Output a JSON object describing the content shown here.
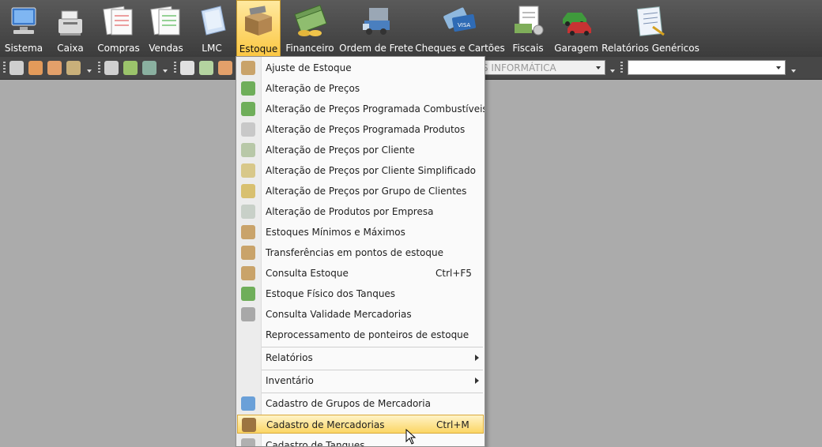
{
  "topbar": {
    "items": [
      {
        "label": "Sistema",
        "icon": "computer-icon"
      },
      {
        "label": "Caixa",
        "icon": "cash-register-icon"
      },
      {
        "label": "Compras",
        "icon": "purchase-forms-icon"
      },
      {
        "label": "Vendas",
        "icon": "sales-forms-icon"
      },
      {
        "label": "LMC",
        "icon": "document-icon"
      },
      {
        "label": "Estoque",
        "icon": "stock-box-icon"
      },
      {
        "label": "Financeiro",
        "icon": "money-icon"
      },
      {
        "label": "Ordem de Frete",
        "icon": "truck-icon"
      },
      {
        "label": "Cheques e Cartões",
        "icon": "cards-icon"
      },
      {
        "label": "Fiscais",
        "icon": "fiscal-icon"
      },
      {
        "label": "Garagem",
        "icon": "cars-icon"
      },
      {
        "label": "Relatórios Genéricos",
        "icon": "reports-icon"
      }
    ]
  },
  "toolbar2": {
    "company_combo": "S INFORMÁTICA",
    "second_combo": ""
  },
  "menu": {
    "items": [
      {
        "label": "Ajuste de Estoque",
        "shortcut": "",
        "icon": "stock-adjust-icon"
      },
      {
        "label": "Alteração de Preços",
        "shortcut": "",
        "icon": "price-change-icon"
      },
      {
        "label": "Alteração de Preços Programada Combustíveis",
        "shortcut": "",
        "icon": "price-fuel-icon"
      },
      {
        "label": "Alteração de Preços Programada Produtos",
        "shortcut": "",
        "icon": "price-products-icon"
      },
      {
        "label": "Alteração de Preços por Cliente",
        "shortcut": "",
        "icon": "price-client-icon"
      },
      {
        "label": "Alteração de Preços por Cliente Simplificado",
        "shortcut": "",
        "icon": "price-client-simple-icon"
      },
      {
        "label": "Alteração de Preços por Grupo de Clientes",
        "shortcut": "",
        "icon": "price-group-icon"
      },
      {
        "label": "Alteração de Produtos por Empresa",
        "shortcut": "",
        "icon": "products-company-icon"
      },
      {
        "label": "Estoques Mínimos e Máximos",
        "shortcut": "",
        "icon": "stock-minmax-icon"
      },
      {
        "label": "Transferências em pontos de estoque",
        "shortcut": "",
        "icon": "transfer-icon"
      },
      {
        "label": "Consulta Estoque",
        "shortcut": "Ctrl+F5",
        "icon": "stock-query-icon"
      },
      {
        "label": "Estoque Físico dos Tanques",
        "shortcut": "",
        "icon": "tank-stock-icon"
      },
      {
        "label": "Consulta Validade Mercadorias",
        "shortcut": "",
        "icon": "validity-icon"
      },
      {
        "label": "Reprocessamento de ponteiros de estoque",
        "shortcut": "",
        "icon": ""
      },
      {
        "label": "Relatórios",
        "shortcut": "",
        "icon": ""
      },
      {
        "label": "Inventário",
        "shortcut": "",
        "icon": ""
      },
      {
        "label": "Cadastro de Grupos de Mercadoria",
        "shortcut": "",
        "icon": "groups-icon"
      },
      {
        "label": "Cadastro de Mercadorias",
        "shortcut": "Ctrl+M",
        "icon": "merchandise-box-icon"
      },
      {
        "label": "Cadastro de Tanques",
        "shortcut": "",
        "icon": "tank-icon"
      }
    ]
  },
  "colors": {
    "topbar_bg": "#4a4a4a",
    "active_tab": "#fbc743",
    "menu_highlight": "#fbd664",
    "workspace": "#ababab"
  }
}
